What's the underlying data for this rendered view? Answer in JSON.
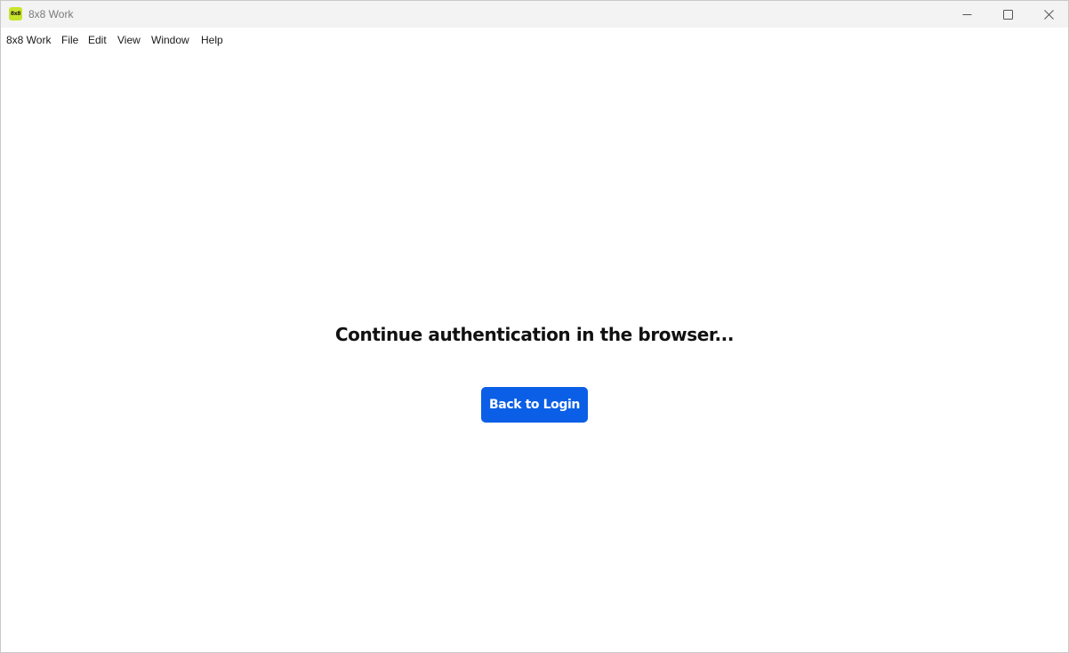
{
  "window": {
    "title": "8x8 Work",
    "icon": "8x8-logo-icon",
    "icon_text": "8x8",
    "icon_color": "#c8e32b",
    "controls": [
      "minimize-icon",
      "maximize-icon",
      "close-icon"
    ]
  },
  "menubar": {
    "items": [
      {
        "label": "8x8 Work"
      },
      {
        "label": "File"
      },
      {
        "label": "Edit"
      },
      {
        "label": "View"
      },
      {
        "label": "Window"
      },
      {
        "label": "Help"
      }
    ]
  },
  "main": {
    "message": "Continue authentication in the browser...",
    "back_button_label": "Back to Login",
    "accent_color": "#0b5fe6"
  }
}
